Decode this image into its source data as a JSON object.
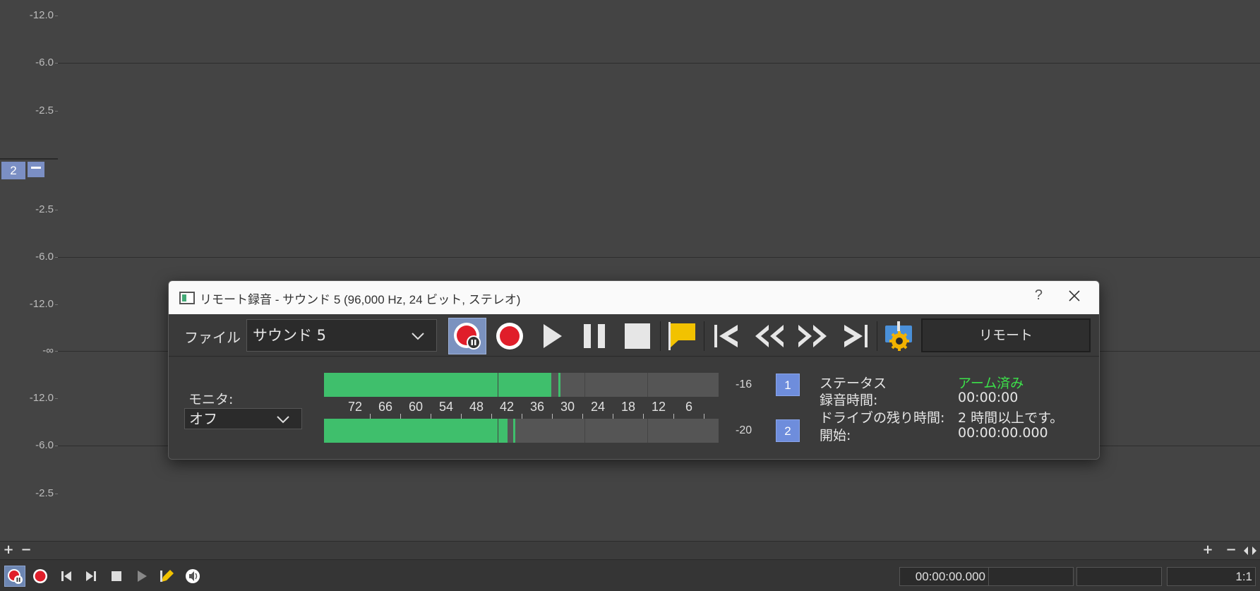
{
  "waveform": {
    "db_labels_top": [
      "-12.0",
      "-6.0",
      "-2.5"
    ],
    "channel_badge": "2",
    "db_labels_bottom": [
      "-2.5",
      "-6.0",
      "-12.0",
      "-∞",
      "-12.0",
      "-6.0",
      "-2.5"
    ]
  },
  "dialog": {
    "title": "リモート録音 - サウンド 5 (96,000 Hz, 24 ビット, ステレオ)",
    "help": "?",
    "toolbar": {
      "file_label": "ファイル",
      "file_value": "サウンド 5",
      "remote_label": "リモート"
    },
    "monitor": {
      "label": "モニタ:",
      "value": "オフ"
    },
    "meters": {
      "scale": [
        "72",
        "66",
        "60",
        "54",
        "48",
        "42",
        "36",
        "30",
        "24",
        "18",
        "12",
        "6"
      ],
      "channels": [
        {
          "id": "1",
          "peak": "-16",
          "level_fraction": 0.576,
          "peak_fraction": 0.594
        },
        {
          "id": "2",
          "peak": "-20",
          "level_fraction": 0.465,
          "peak_fraction": 0.479
        }
      ]
    },
    "info": {
      "status_label": "ステータス",
      "status_value": "アーム済み",
      "rec_time_label": "録音時間:",
      "rec_time_value": "00:00:00",
      "drive_label": "ドライブの残り時間:",
      "drive_value": "2 時間以上です。",
      "start_label": "開始:",
      "start_value": "00:00:00.000"
    }
  },
  "bottom_bar": {
    "time": "00:00:00.000",
    "time2": "",
    "time3": "",
    "ratio": "1:1"
  },
  "zoom_strip": {
    "left_plus": "+",
    "left_minus": "−",
    "right_plus": "+",
    "right_minus": "−"
  },
  "colors": {
    "meter_green": "#3fbf6c",
    "status_green": "#3ce04a",
    "channel_blue": "#6e8ddc",
    "record_red": "#e01e2a",
    "marker_yellow": "#f2c200"
  }
}
